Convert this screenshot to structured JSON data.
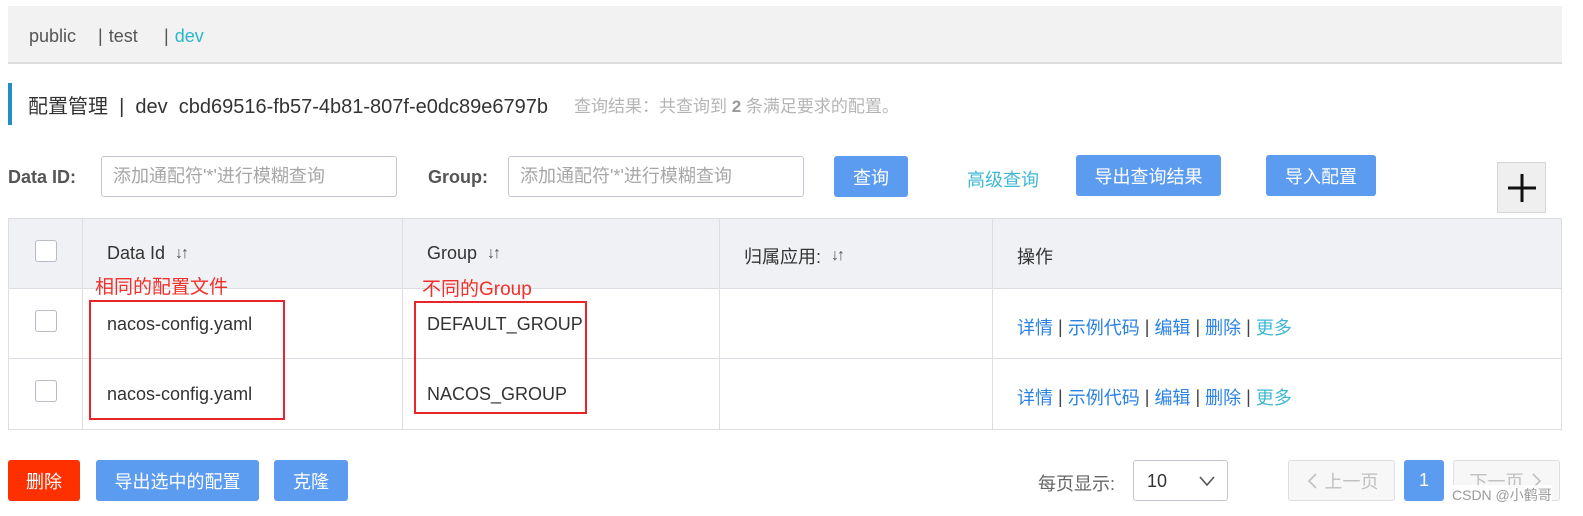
{
  "namespaces": {
    "items": [
      "public",
      "test",
      "dev"
    ],
    "separator": "|"
  },
  "title": {
    "main": "配置管理  |  dev  cbd69516-fb57-4b81-807f-e0dc89e6797b",
    "result_prefix": "查询结果：共查询到",
    "result_count": "2",
    "result_suffix": "条满足要求的配置。"
  },
  "search": {
    "data_id_label": "Data ID:",
    "data_id_placeholder": "添加通配符'*'进行模糊查询",
    "group_label": "Group:",
    "group_placeholder": "添加通配符'*'进行模糊查询",
    "query_button": "查询",
    "advanced_link": "高级查询",
    "export_button": "导出查询结果",
    "import_button": "导入配置"
  },
  "table": {
    "headers": {
      "data_id": "Data Id",
      "group": "Group",
      "app": "归属应用:",
      "ops": "操作"
    },
    "sort_icon": "↓↑",
    "rows": [
      {
        "data_id": "nacos-config.yaml",
        "group": "DEFAULT_GROUP",
        "app": ""
      },
      {
        "data_id": "nacos-config.yaml",
        "group": "NACOS_GROUP",
        "app": ""
      }
    ],
    "ops": {
      "detail": "详情",
      "sample_code": "示例代码",
      "edit": "编辑",
      "delete": "删除",
      "more": "更多",
      "separator": "|"
    }
  },
  "annotations": {
    "same_file": "相同的配置文件",
    "different_group": "不同的Group"
  },
  "footer": {
    "delete_button": "删除",
    "export_selected_button": "导出选中的配置",
    "clone_button": "克隆",
    "page_size_label": "每页显示:",
    "page_size_value": "10",
    "prev_page": "上一页",
    "current_page": "1",
    "next_page": "下一页"
  },
  "watermark": "CSDN @小鹤哥",
  "colors": {
    "primary_button": "#5b9bf0",
    "danger_button": "#ff3000",
    "link": "#2a82e4",
    "cyan_link": "#3fb7d4",
    "annotation_red": "#e8262a"
  }
}
